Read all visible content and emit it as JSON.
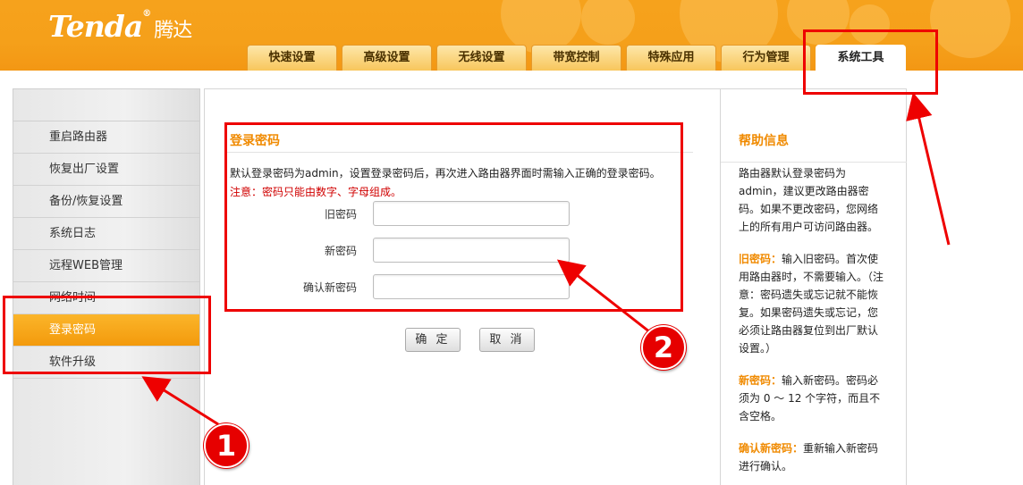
{
  "brand": {
    "name": "Tenda",
    "reg": "®",
    "cn": "腾达"
  },
  "tabs": [
    "快速设置",
    "高级设置",
    "无线设置",
    "带宽控制",
    "特殊应用",
    "行为管理",
    "系统工具"
  ],
  "active_tab": "系统工具",
  "sidebar": {
    "items": [
      "重启路由器",
      "恢复出厂设置",
      "备份/恢复设置",
      "系统日志",
      "远程WEB管理",
      "网络时间",
      "登录密码",
      "软件升级"
    ],
    "active": "登录密码"
  },
  "main": {
    "title": "登录密码",
    "description": "默认登录密码为admin，设置登录密码后，再次进入路由器界面时需输入正确的登录密码。",
    "note": "注意：密码只能由数字、字母组成。",
    "fields": [
      {
        "label": "旧密码",
        "value": ""
      },
      {
        "label": "新密码",
        "value": ""
      },
      {
        "label": "确认新密码",
        "value": ""
      }
    ],
    "ok_label": "确 定",
    "cancel_label": "取 消"
  },
  "help": {
    "title": "帮助信息",
    "intro": "路由器默认登录密码为admin，建议更改路由器密码。如果不更改密码，您网络上的所有用户可访问路由器。",
    "items": [
      {
        "term": "旧密码：",
        "text": "输入旧密码。首次使用路由器时，不需要输入。（注意：密码遗失或忘记就不能恢复。如果密码遗失或忘记，您必须让路由器复位到出厂默认设置。）"
      },
      {
        "term": "新密码：",
        "text": "输入新密码。密码必须为 0 ～ 12 个字符，而且不含空格。"
      },
      {
        "term": "确认新密码：",
        "text": "重新输入新密码进行确认。"
      }
    ]
  },
  "annotations": {
    "badge1": "1",
    "badge2": "2"
  },
  "colors": {
    "brand_orange": "#f5a01a",
    "highlight": "#f08a00",
    "annotation_red": "#ee0000"
  }
}
